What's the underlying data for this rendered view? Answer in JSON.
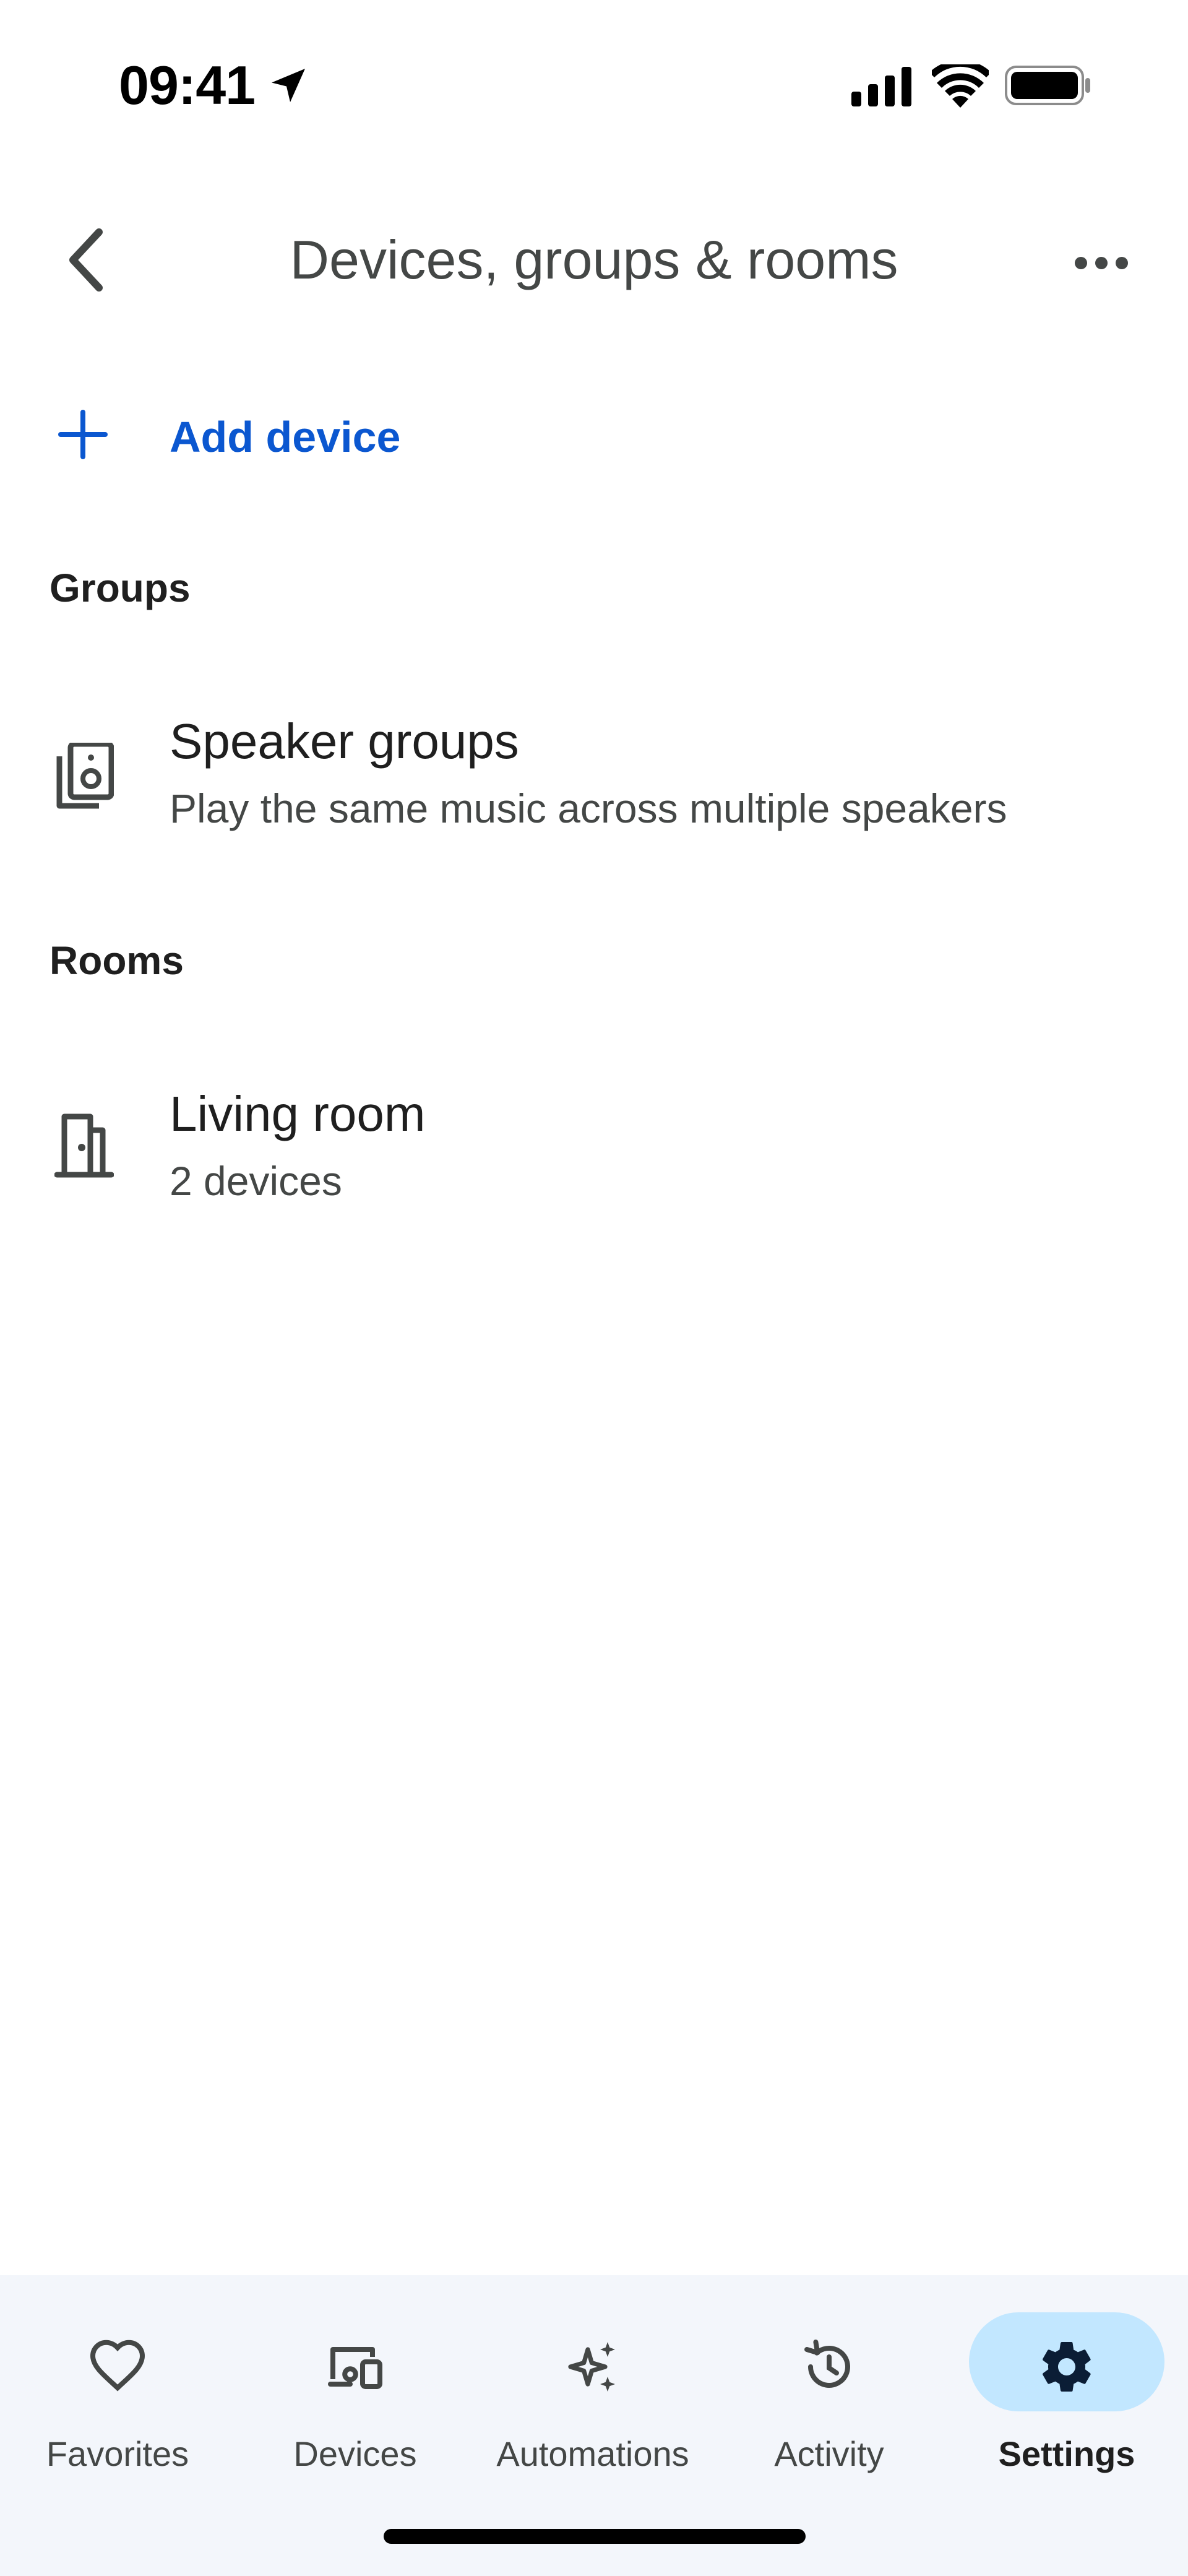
{
  "status_bar": {
    "time": "09:41"
  },
  "header": {
    "title": "Devices, groups & rooms"
  },
  "add_device": {
    "label": "Add device"
  },
  "sections": {
    "groups": {
      "heading": "Groups",
      "items": [
        {
          "title": "Speaker groups",
          "subtitle": "Play the same music across multiple speakers",
          "icon": "speaker-group-icon"
        }
      ]
    },
    "rooms": {
      "heading": "Rooms",
      "items": [
        {
          "title": "Living room",
          "subtitle": "2 devices",
          "icon": "door-icon"
        }
      ]
    }
  },
  "bottom_nav": {
    "items": [
      {
        "label": "Favorites",
        "icon": "heart-icon"
      },
      {
        "label": "Devices",
        "icon": "devices-icon"
      },
      {
        "label": "Automations",
        "icon": "sparkle-icon"
      },
      {
        "label": "Activity",
        "icon": "history-icon"
      },
      {
        "label": "Settings",
        "icon": "gear-icon",
        "active": true
      }
    ]
  },
  "colors": {
    "accent": "#0b57d0",
    "nav_active_pill": "#c2e7ff",
    "nav_background": "#f3f6fb"
  }
}
